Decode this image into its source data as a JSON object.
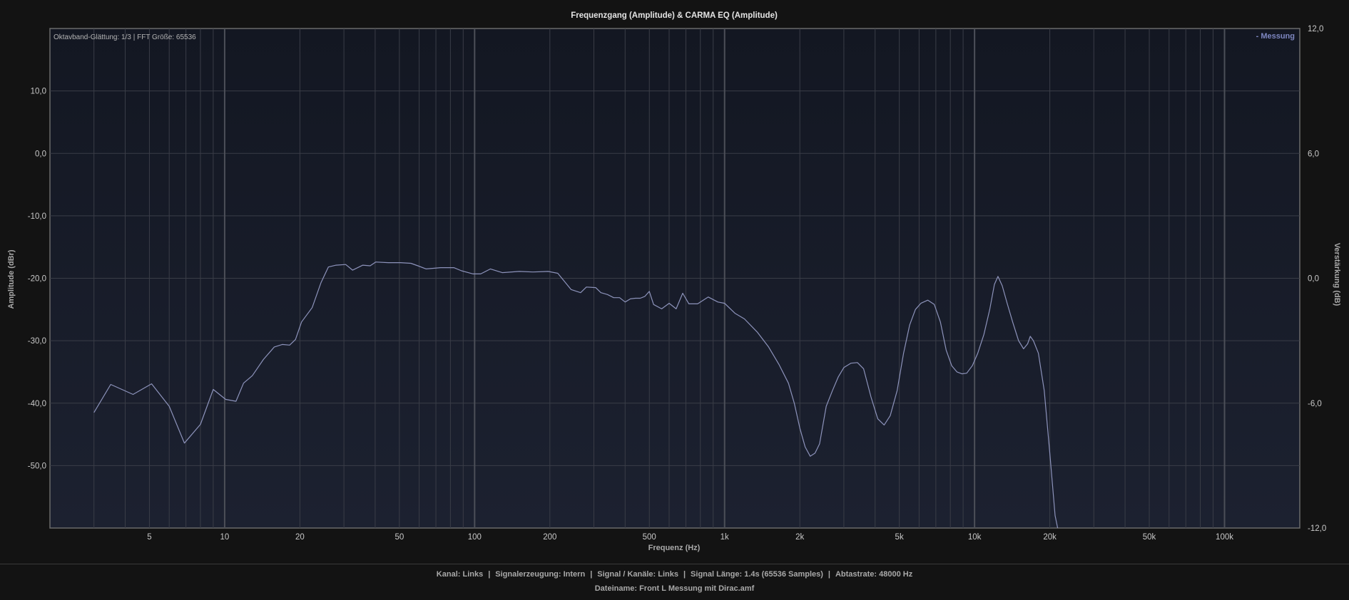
{
  "chart_data": {
    "type": "line",
    "title": "Frequenzgang (Amplitude) & CARMA EQ (Amplitude)",
    "info": "Oktavband-Glättung: 1/3 | FFT Größe: 65536",
    "xlabel": "Frequenz (Hz)",
    "ylabel": "Amplitude (dBr)",
    "y2label": "Verstärkung (dB)",
    "x_scale": "log",
    "xlim": [
      2,
      200000
    ],
    "ylim": [
      -60,
      20
    ],
    "y2lim": [
      -12,
      12
    ],
    "grid": true,
    "legend_position": "top-right",
    "x_ticks": [
      {
        "v": 5,
        "label": "5"
      },
      {
        "v": 10,
        "label": "10"
      },
      {
        "v": 20,
        "label": "20"
      },
      {
        "v": 50,
        "label": "50"
      },
      {
        "v": 100,
        "label": "100"
      },
      {
        "v": 200,
        "label": "200"
      },
      {
        "v": 500,
        "label": "500"
      },
      {
        "v": 1000,
        "label": "1k"
      },
      {
        "v": 2000,
        "label": "2k"
      },
      {
        "v": 5000,
        "label": "5k"
      },
      {
        "v": 10000,
        "label": "10k"
      },
      {
        "v": 20000,
        "label": "20k"
      },
      {
        "v": 50000,
        "label": "50k"
      },
      {
        "v": 100000,
        "label": "100k"
      }
    ],
    "y_ticks": [
      {
        "v": 10,
        "label": "10,0"
      },
      {
        "v": 0,
        "label": "0,0"
      },
      {
        "v": -10,
        "label": "-10,0"
      },
      {
        "v": -20,
        "label": "-20,0"
      },
      {
        "v": -30,
        "label": "-30,0"
      },
      {
        "v": -40,
        "label": "-40,0"
      },
      {
        "v": -50,
        "label": "-50,0"
      }
    ],
    "y2_ticks": [
      {
        "v": 12,
        "label": "12,0"
      },
      {
        "v": 6,
        "label": "6,0"
      },
      {
        "v": 0,
        "label": "0,0"
      },
      {
        "v": -6,
        "label": "-6,0"
      },
      {
        "v": -12,
        "label": "-12,0"
      }
    ],
    "series": [
      {
        "name": "Messung",
        "legend_label": "- Messung",
        "color": "#8d93bb",
        "points": [
          [
            3.0,
            -41.5
          ],
          [
            3.5,
            -37.0
          ],
          [
            4.3,
            -38.6
          ],
          [
            5.1,
            -36.9
          ],
          [
            6.0,
            -40.5
          ],
          [
            6.9,
            -46.4
          ],
          [
            8.0,
            -43.4
          ],
          [
            9.0,
            -37.8
          ],
          [
            10.1,
            -39.4
          ],
          [
            11.1,
            -39.7
          ],
          [
            11.9,
            -36.8
          ],
          [
            12.9,
            -35.6
          ],
          [
            14.3,
            -33.0
          ],
          [
            15.8,
            -31.0
          ],
          [
            17.0,
            -30.6
          ],
          [
            18.2,
            -30.7
          ],
          [
            19.2,
            -29.8
          ],
          [
            20.3,
            -27.0
          ],
          [
            22.4,
            -24.7
          ],
          [
            24.3,
            -20.7
          ],
          [
            26.0,
            -18.2
          ],
          [
            27.9,
            -17.9
          ],
          [
            30.5,
            -17.8
          ],
          [
            32.5,
            -18.7
          ],
          [
            35.7,
            -17.9
          ],
          [
            38.2,
            -18.0
          ],
          [
            40.2,
            -17.4
          ],
          [
            45.1,
            -17.5
          ],
          [
            50.6,
            -17.5
          ],
          [
            55.6,
            -17.6
          ],
          [
            59.3,
            -18.0
          ],
          [
            64.0,
            -18.5
          ],
          [
            73.1,
            -18.3
          ],
          [
            82.6,
            -18.3
          ],
          [
            88.6,
            -18.8
          ],
          [
            98.6,
            -19.3
          ],
          [
            105.7,
            -19.3
          ],
          [
            115.7,
            -18.5
          ],
          [
            129.0,
            -19.1
          ],
          [
            150.9,
            -18.9
          ],
          [
            171.1,
            -19.0
          ],
          [
            196.9,
            -18.9
          ],
          [
            215.1,
            -19.2
          ],
          [
            243.1,
            -21.8
          ],
          [
            265.5,
            -22.3
          ],
          [
            280.0,
            -21.4
          ],
          [
            305.0,
            -21.5
          ],
          [
            320.0,
            -22.3
          ],
          [
            340.0,
            -22.6
          ],
          [
            360.0,
            -23.1
          ],
          [
            380.0,
            -23.1
          ],
          [
            400.0,
            -23.8
          ],
          [
            420.0,
            -23.3
          ],
          [
            440.0,
            -23.2
          ],
          [
            460.0,
            -23.2
          ],
          [
            480.0,
            -22.9
          ],
          [
            500.0,
            -22.1
          ],
          [
            520.0,
            -24.2
          ],
          [
            560.0,
            -24.9
          ],
          [
            600.0,
            -24.0
          ],
          [
            640.0,
            -24.9
          ],
          [
            680.0,
            -22.4
          ],
          [
            720.0,
            -24.1
          ],
          [
            780.0,
            -24.1
          ],
          [
            860.0,
            -23.0
          ],
          [
            940.0,
            -23.8
          ],
          [
            1000.0,
            -24.0
          ],
          [
            1100.0,
            -25.6
          ],
          [
            1200.0,
            -26.5
          ],
          [
            1350.0,
            -28.6
          ],
          [
            1500.0,
            -31.0
          ],
          [
            1650.0,
            -33.8
          ],
          [
            1800.0,
            -36.8
          ],
          [
            1900.0,
            -40.0
          ],
          [
            2000.0,
            -44.0
          ],
          [
            2100.0,
            -47.0
          ],
          [
            2200.0,
            -48.5
          ],
          [
            2300.0,
            -48.0
          ],
          [
            2400.0,
            -46.5
          ],
          [
            2550.0,
            -40.5
          ],
          [
            2700.0,
            -38.0
          ],
          [
            2850.0,
            -35.8
          ],
          [
            3000.0,
            -34.3
          ],
          [
            3200.0,
            -33.6
          ],
          [
            3400.0,
            -33.5
          ],
          [
            3600.0,
            -34.5
          ],
          [
            3850.0,
            -39.0
          ],
          [
            4100.0,
            -42.5
          ],
          [
            4350.0,
            -43.5
          ],
          [
            4600.0,
            -42.0
          ],
          [
            4900.0,
            -38.0
          ],
          [
            5200.0,
            -32.0
          ],
          [
            5500.0,
            -27.5
          ],
          [
            5800.0,
            -25.0
          ],
          [
            6100.0,
            -24.0
          ],
          [
            6500.0,
            -23.5
          ],
          [
            6900.0,
            -24.2
          ],
          [
            7300.0,
            -27.0
          ],
          [
            7700.0,
            -31.5
          ],
          [
            8100.0,
            -34.0
          ],
          [
            8500.0,
            -35.0
          ],
          [
            8900.0,
            -35.3
          ],
          [
            9300.0,
            -35.2
          ],
          [
            9800.0,
            -34.0
          ],
          [
            10300.0,
            -32.0
          ],
          [
            10900.0,
            -29.0
          ],
          [
            11500.0,
            -25.0
          ],
          [
            12000.0,
            -21.0
          ],
          [
            12400.0,
            -19.7
          ],
          [
            12900.0,
            -21.2
          ],
          [
            13500.0,
            -24.0
          ],
          [
            14200.0,
            -27.0
          ],
          [
            15000.0,
            -30.0
          ],
          [
            15700.0,
            -31.3
          ],
          [
            16300.0,
            -30.5
          ],
          [
            16700.0,
            -29.3
          ],
          [
            17200.0,
            -30.0
          ],
          [
            18000.0,
            -32.0
          ],
          [
            19000.0,
            -38.0
          ],
          [
            20000.0,
            -48.0
          ],
          [
            21000.0,
            -58.0
          ],
          [
            21500.0,
            -60.0
          ]
        ]
      }
    ]
  },
  "footer": {
    "kanal": "Kanal: Links",
    "signalerzeugung": "Signalerzeugung: Intern",
    "signal_kanaele": "Signal / Kanäle: Links",
    "signal_laenge": "Signal Länge: 1.4s (65536 Samples)",
    "abtastrate": "Abtastrate: 48000 Hz",
    "sep": "|",
    "dateiname": "Dateiname: Front L Messung mit Dirac.amf"
  }
}
